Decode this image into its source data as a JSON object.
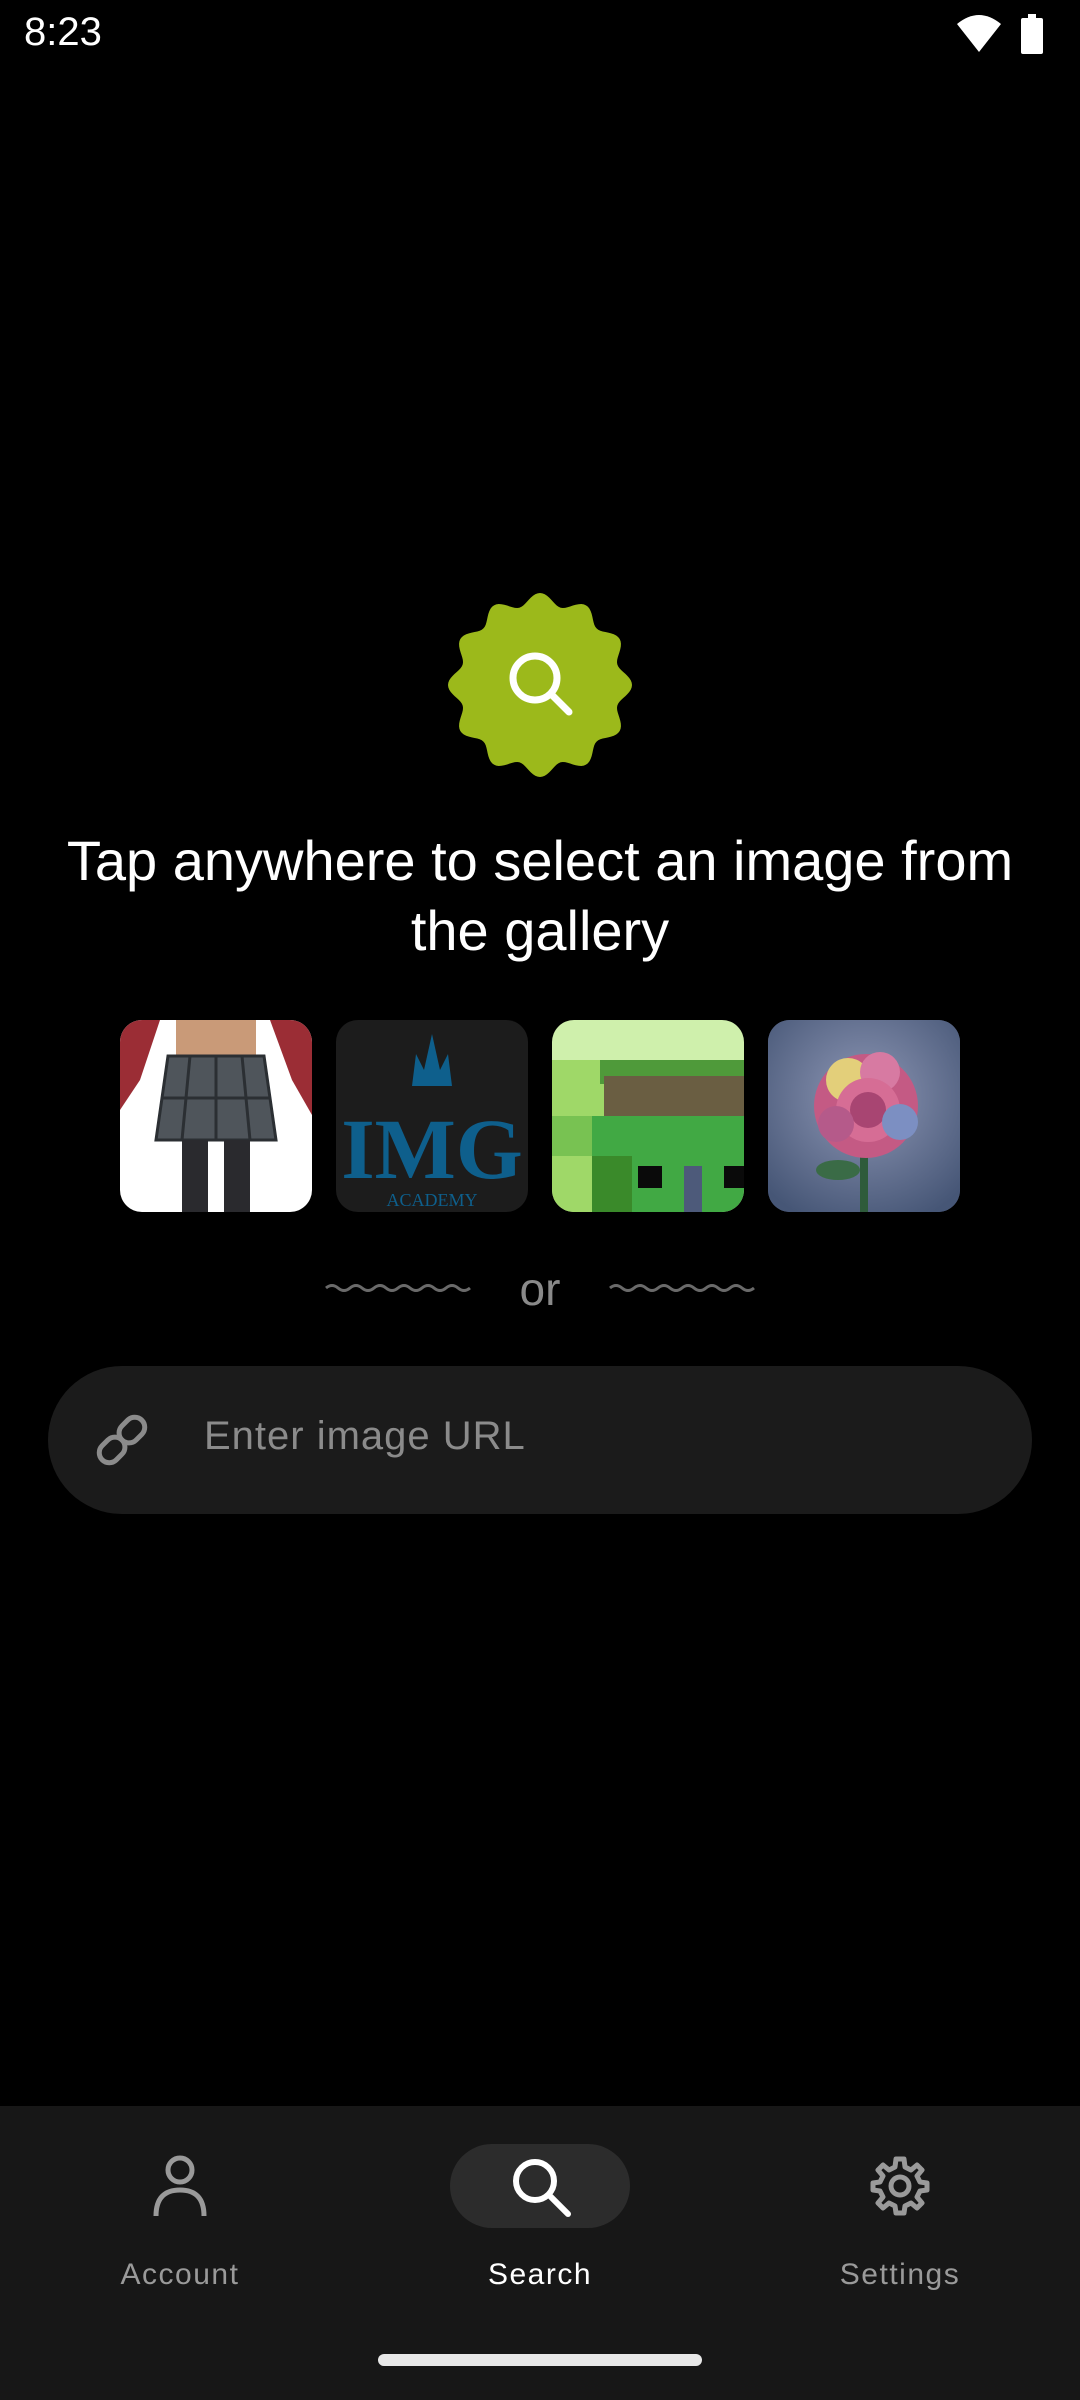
{
  "status_bar": {
    "time": "8:23",
    "icons": [
      "wifi-icon",
      "battery-icon"
    ]
  },
  "main": {
    "badge_icon": "search-icon",
    "headline": "Tap anywhere to select an image from the gallery",
    "samples": [
      {
        "name": "sample-image-anime-skirt"
      },
      {
        "name": "sample-image-img-academy",
        "logo_text": "IMG",
        "logo_subtext": "ACADEMY"
      },
      {
        "name": "sample-image-pixel-art"
      },
      {
        "name": "sample-image-rose"
      }
    ],
    "or_label": "or",
    "url_input": {
      "icon": "link-icon",
      "placeholder": "Enter image URL"
    }
  },
  "nav": {
    "items": [
      {
        "label": "Account",
        "icon": "person-icon",
        "active": false
      },
      {
        "label": "Search",
        "icon": "search-icon",
        "active": true
      },
      {
        "label": "Settings",
        "icon": "gear-icon",
        "active": false
      }
    ]
  },
  "colors": {
    "accent": "#9cb91b",
    "background": "#000000",
    "surface": "#1b1b1b",
    "nav_background": "#171717"
  }
}
